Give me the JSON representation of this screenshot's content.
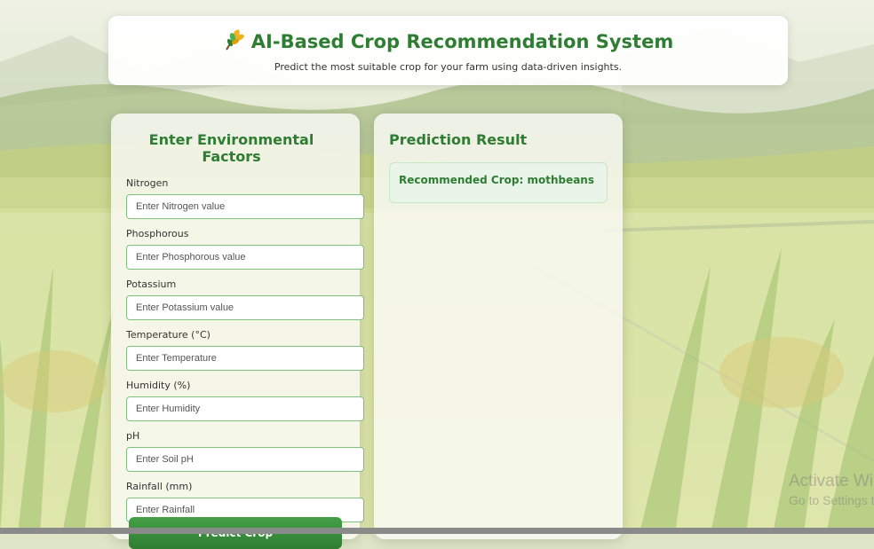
{
  "header": {
    "icon": "wheat-icon",
    "title": "AI-Based Crop Recommendation System",
    "subtitle": "Predict the most suitable crop for your farm using data-driven insights."
  },
  "form": {
    "title": "Enter Environmental Factors",
    "fields": [
      {
        "label": "Nitrogen",
        "placeholder": "Enter Nitrogen value",
        "value": ""
      },
      {
        "label": "Phosphorous",
        "placeholder": "Enter Phosphorous value",
        "value": ""
      },
      {
        "label": "Potassium",
        "placeholder": "Enter Potassium value",
        "value": ""
      },
      {
        "label": "Temperature (°C)",
        "placeholder": "Enter Temperature",
        "value": ""
      },
      {
        "label": "Humidity (%)",
        "placeholder": "Enter Humidity",
        "value": ""
      },
      {
        "label": "pH",
        "placeholder": "Enter Soil pH",
        "value": ""
      },
      {
        "label": "Rainfall (mm)",
        "placeholder": "Enter Rainfall",
        "value": ""
      }
    ],
    "submit_label": "Predict Crop"
  },
  "result": {
    "title": "Prediction Result",
    "text": "Recommended Crop: mothbeans"
  },
  "watermark": {
    "line1": "Activate Windows",
    "line2": "Go to Settings to activate Windows."
  },
  "colors": {
    "accent": "#2e7d32",
    "input_border": "#7fbf7f",
    "result_bg": "#e8f5e9"
  }
}
